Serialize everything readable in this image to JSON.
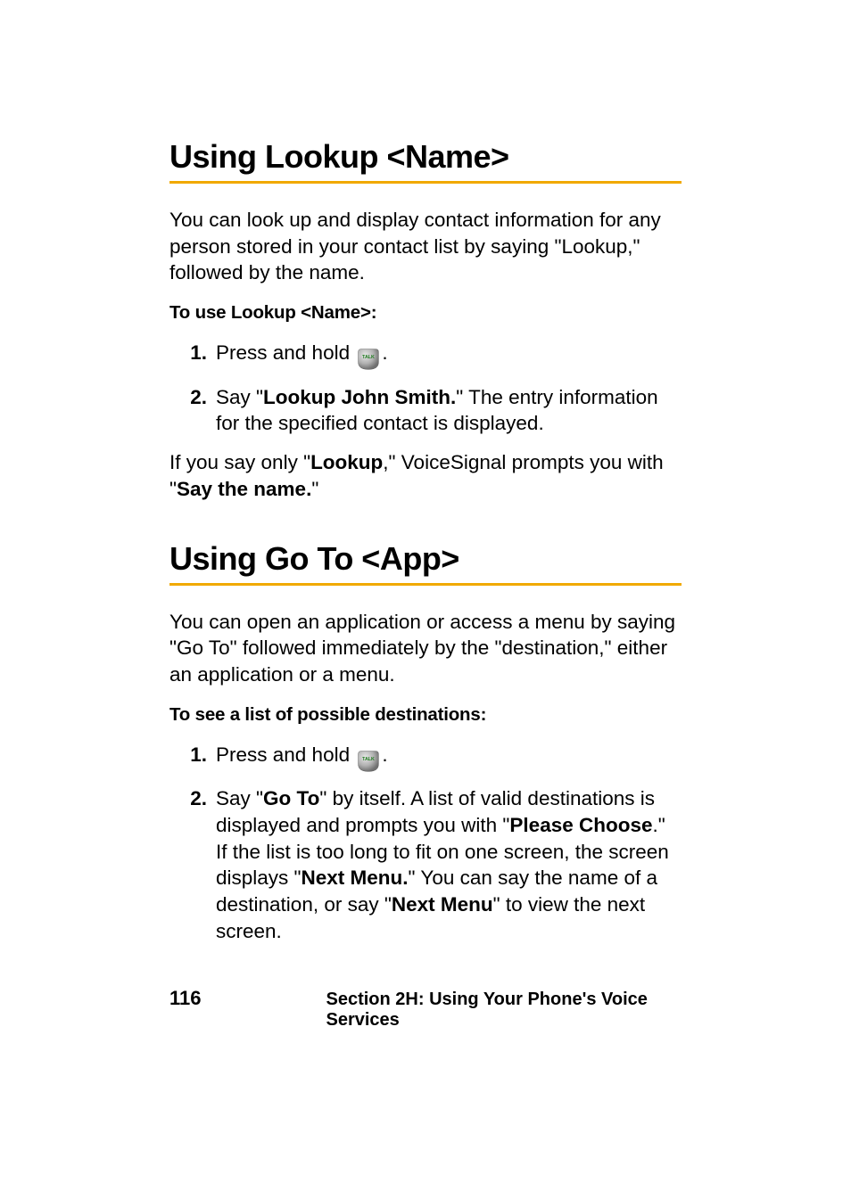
{
  "section1": {
    "heading": "Using Lookup <Name>",
    "intro": "You can look up and display contact information for any person stored in your contact list by saying \"Lookup,\" followed by the name.",
    "subhead": "To use Lookup <Name>:",
    "step1_num": "1.",
    "step1_pre": "Press and hold ",
    "step1_post": ".",
    "step2_num": "2.",
    "step2_a": "Say \"",
    "step2_b": "Lookup John Smith.",
    "step2_c": "\" The entry information for the specified contact is displayed.",
    "note_a": "If you say only \"",
    "note_b": "Lookup",
    "note_c": ",\" VoiceSignal prompts you with \"",
    "note_d": "Say the name.",
    "note_e": "\""
  },
  "section2": {
    "heading": "Using Go To <App>",
    "intro": "You can open an application or access a menu by saying \"Go To\" followed immediately by the \"destination,\" either an application or a menu.",
    "subhead": "To see a list of possible destinations:",
    "step1_num": "1.",
    "step1_pre": "Press and hold ",
    "step1_post": ".",
    "step2_num": "2.",
    "step2_a": "Say \"",
    "step2_b": "Go To",
    "step2_c": "\" by itself. A list of valid destinations is displayed and prompts you with \"",
    "step2_d": "Please Choose",
    "step2_e": ".\" If the list is too long to fit on one screen, the screen displays \"",
    "step2_f": "Next Menu.",
    "step2_g": "\" You can say the name of a destination, or say \"",
    "step2_h": "Next Menu",
    "step2_i": "\" to view the next screen."
  },
  "footer": {
    "page": "116",
    "section": "Section 2H: Using Your Phone's Voice Services"
  },
  "icons": {
    "talk": "talk-button-icon"
  }
}
